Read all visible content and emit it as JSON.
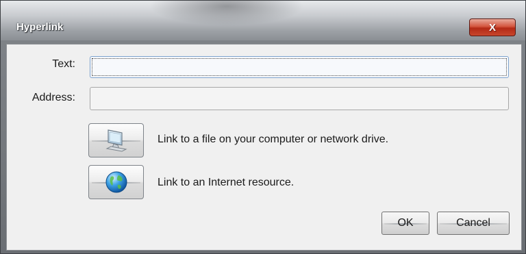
{
  "window": {
    "title": "Hyperlink",
    "close_label": "X"
  },
  "form": {
    "text_label": "Text:",
    "text_value": "",
    "address_label": "Address:",
    "address_value": ""
  },
  "links": [
    {
      "icon": "computer-icon",
      "label": "Link to a file on your computer or network drive."
    },
    {
      "icon": "globe-icon",
      "label": "Link to an Internet resource."
    }
  ],
  "buttons": {
    "ok": "OK",
    "cancel": "Cancel"
  }
}
